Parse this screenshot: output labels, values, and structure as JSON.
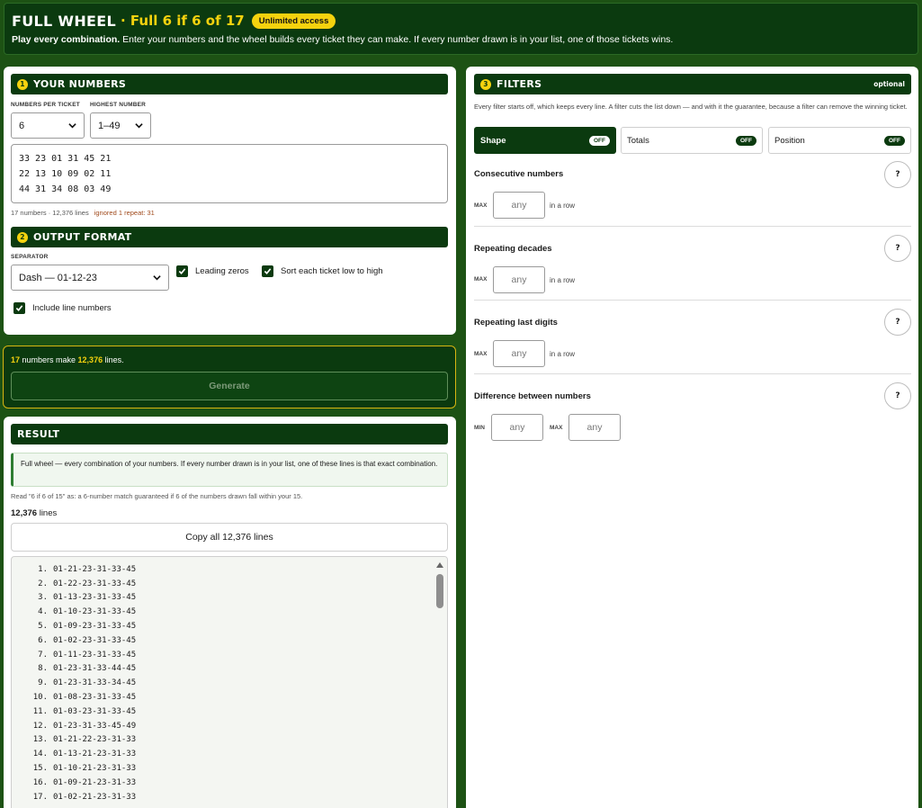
{
  "header": {
    "title": "FULL WHEEL",
    "subtitle": "· Full 6 if 6 of 17",
    "badge": "Unlimited access",
    "desc_bold": "Play every combination.",
    "desc": " Enter your numbers and the wheel builds every ticket they can make. If every number drawn is in your list, one of those tickets wins."
  },
  "numbers_section": {
    "step": "1",
    "title": "YOUR NUMBERS",
    "per_ticket_label": "NUMBERS PER TICKET",
    "per_ticket_value": "6",
    "highest_label": "HIGHEST NUMBER",
    "highest_value": "1–49",
    "input_text": "33 23 01 31 45 21\n22 13 10 09 02 11\n44 31 34 08 03 49",
    "stats": "17 numbers · 12,376 lines",
    "warning": "ignored 1 repeat: 31"
  },
  "output_section": {
    "step": "2",
    "title": "OUTPUT FORMAT",
    "separator_label": "SEPARATOR",
    "separator_value": "Dash — 01-12-23",
    "leading_zeros": "Leading zeros",
    "sort_low_high": "Sort each ticket low to high",
    "line_numbers": "Include line numbers"
  },
  "generate": {
    "count_numbers": "17",
    "text_mid": " numbers make ",
    "count_lines": "12,376",
    "text_end": " lines.",
    "button": "Generate"
  },
  "result": {
    "title": "RESULT",
    "info": "Full wheel — every combination of your numbers. If every number drawn is in your list, one of these lines is that exact combination.",
    "note": "Read \"6 if 6 of 15\" as: a 6-number match guaranteed if 6 of the numbers drawn fall within your 15.",
    "lines_count": "12,376",
    "lines_word": " lines",
    "copy_button": "Copy all 12,376 lines",
    "lines": [
      {
        "n": "1.",
        "t": "01-21-23-31-33-45"
      },
      {
        "n": "2.",
        "t": "01-22-23-31-33-45"
      },
      {
        "n": "3.",
        "t": "01-13-23-31-33-45"
      },
      {
        "n": "4.",
        "t": "01-10-23-31-33-45"
      },
      {
        "n": "5.",
        "t": "01-09-23-31-33-45"
      },
      {
        "n": "6.",
        "t": "01-02-23-31-33-45"
      },
      {
        "n": "7.",
        "t": "01-11-23-31-33-45"
      },
      {
        "n": "8.",
        "t": "01-23-31-33-44-45"
      },
      {
        "n": "9.",
        "t": "01-23-31-33-34-45"
      },
      {
        "n": "10.",
        "t": "01-08-23-31-33-45"
      },
      {
        "n": "11.",
        "t": "01-03-23-31-33-45"
      },
      {
        "n": "12.",
        "t": "01-23-31-33-45-49"
      },
      {
        "n": "13.",
        "t": "01-21-22-23-31-33"
      },
      {
        "n": "14.",
        "t": "01-13-21-23-31-33"
      },
      {
        "n": "15.",
        "t": "01-10-21-23-31-33"
      },
      {
        "n": "16.",
        "t": "01-09-21-23-31-33"
      },
      {
        "n": "17.",
        "t": "01-02-21-23-31-33"
      }
    ]
  },
  "filters": {
    "step": "3",
    "title": "FILTERS",
    "optional": "optional",
    "desc": "Every filter starts off, which keeps every line. A filter cuts the list down — and with it the guarantee, because a filter can remove the winning ticket.",
    "tabs": [
      {
        "label": "Shape",
        "state": "OFF"
      },
      {
        "label": "Totals",
        "state": "OFF"
      },
      {
        "label": "Position",
        "state": "OFF"
      }
    ],
    "consecutive": {
      "name": "Consecutive numbers",
      "label": "MAX",
      "placeholder": "any",
      "suffix": "in a row"
    },
    "decades": {
      "name": "Repeating decades",
      "label": "MAX",
      "placeholder": "any",
      "suffix": "in a row"
    },
    "last_digits": {
      "name": "Repeating last digits",
      "label": "MAX",
      "placeholder": "any",
      "suffix": "in a row"
    },
    "difference": {
      "name": "Difference between numbers",
      "min_label": "MIN",
      "max_label": "MAX",
      "placeholder": "any"
    },
    "help": "?"
  }
}
